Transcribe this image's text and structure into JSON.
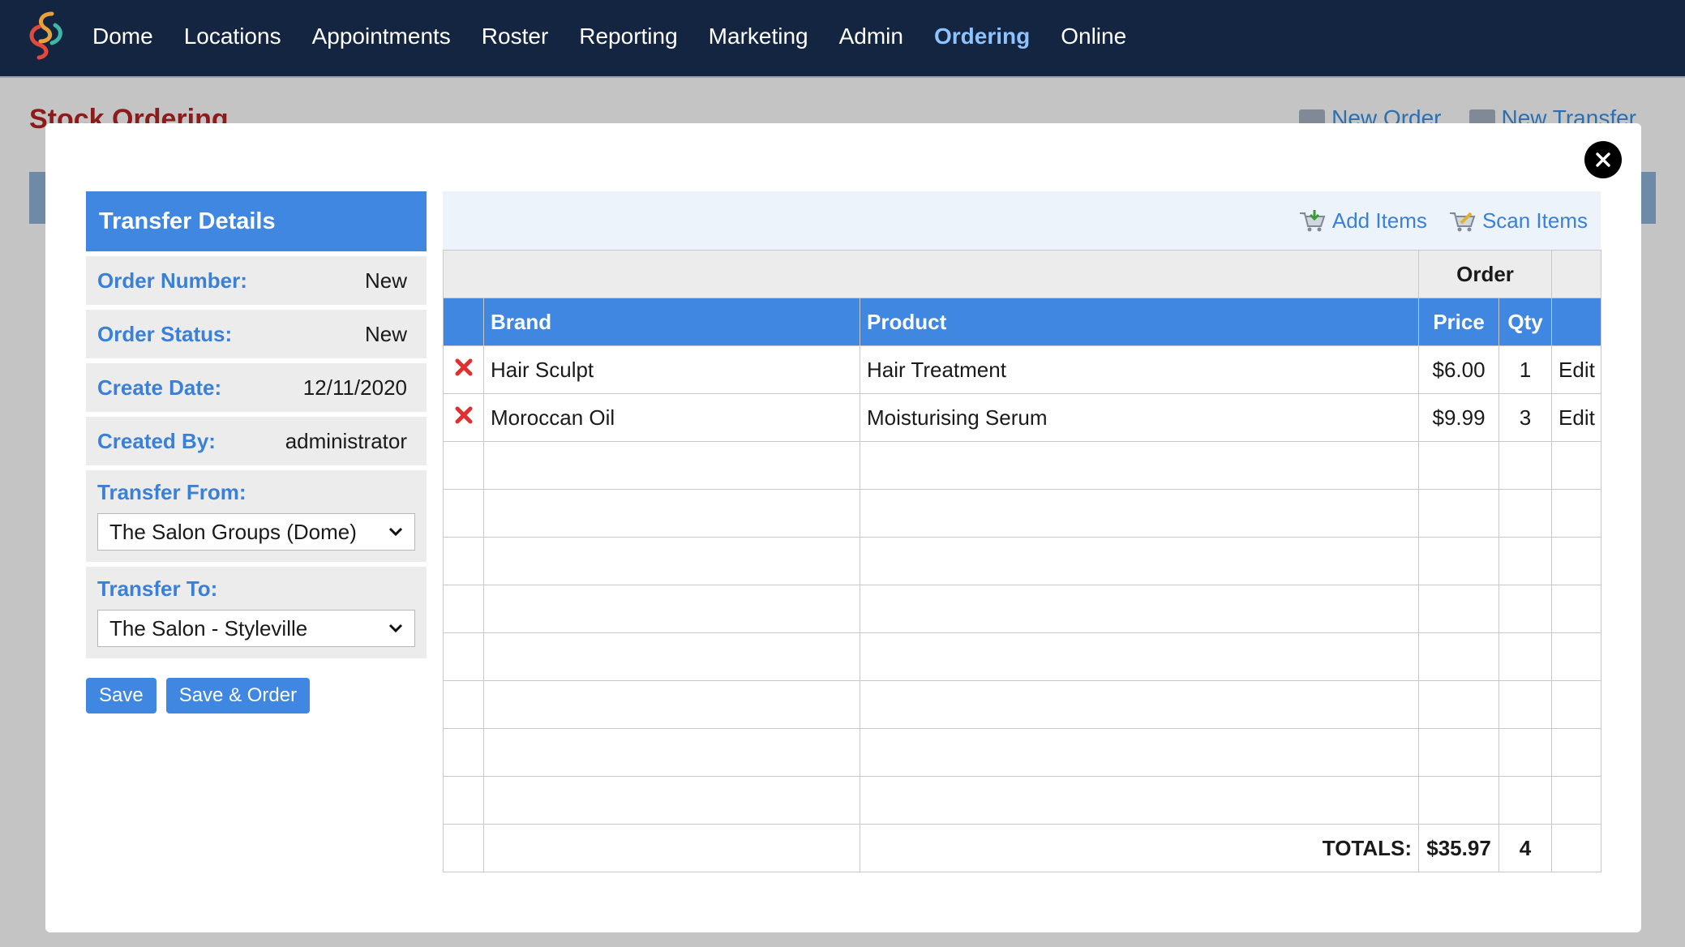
{
  "nav": {
    "items": [
      "Dome",
      "Locations",
      "Appointments",
      "Roster",
      "Reporting",
      "Marketing",
      "Admin",
      "Ordering",
      "Online"
    ],
    "active": "Ordering"
  },
  "background_page": {
    "title": "Stock Ordering",
    "new_order": "New Order",
    "new_transfer": "New Transfer"
  },
  "transfer_details": {
    "header": "Transfer Details",
    "order_number_label": "Order Number:",
    "order_number": "New",
    "order_status_label": "Order Status:",
    "order_status": "New",
    "create_date_label": "Create Date:",
    "create_date": "12/11/2020",
    "created_by_label": "Created By:",
    "created_by": "administrator",
    "transfer_from_label": "Transfer From:",
    "transfer_from": "The Salon Groups (Dome)",
    "transfer_to_label": "Transfer To:",
    "transfer_to": "The Salon - Styleville",
    "save_label": "Save",
    "save_order_label": "Save & Order"
  },
  "toolbar": {
    "add_items": "Add Items",
    "scan_items": "Scan Items"
  },
  "table": {
    "group_header": "Order",
    "columns": [
      "Brand",
      "Product",
      "Price",
      "Qty"
    ],
    "rows": [
      {
        "brand": "Hair Sculpt",
        "product": "Hair Treatment",
        "price": "$6.00",
        "qty": "1",
        "action": "Edit"
      },
      {
        "brand": "Moroccan Oil",
        "product": "Moisturising Serum",
        "price": "$9.99",
        "qty": "3",
        "action": "Edit"
      }
    ],
    "totals_label": "TOTALS:",
    "total_price": "$35.97",
    "total_qty": "4"
  },
  "colors": {
    "nav_bg": "#132540",
    "accent_blue": "#3f87e0",
    "delete_red": "#e03030",
    "active_nav": "#8ec3ff"
  }
}
